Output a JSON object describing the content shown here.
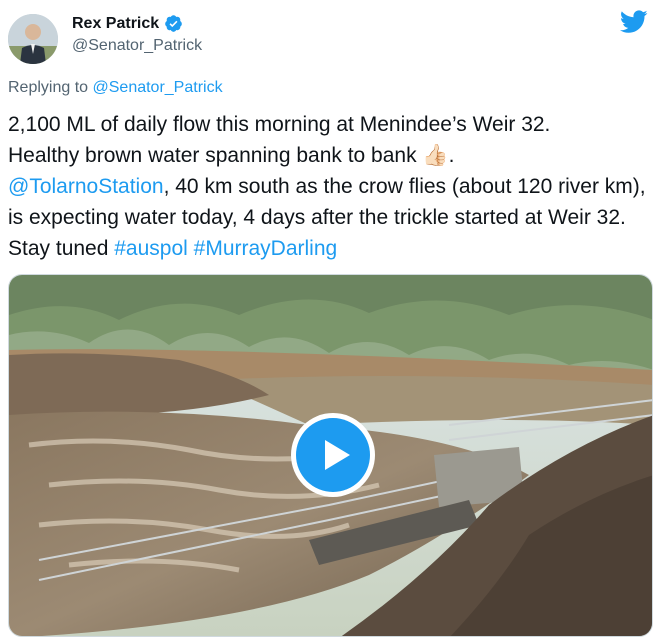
{
  "author": {
    "name": "Rex Patrick",
    "handle": "@Senator_Patrick"
  },
  "reply": {
    "prefix": "Replying to ",
    "mention": "@Senator_Patrick"
  },
  "tweet": {
    "line1": "2,100 ML of daily flow this morning at Menindee’s Weir 32.",
    "line2a": "Healthy brown water spanning bank to bank ",
    "emoji": "👍🏻",
    "line2b": ".",
    "mention": "@TolarnoStation",
    "line3": ", 40 km south as the crow flies (about 120 river km), is expecting water today, 4 days after the trickle started at Weir 32. Stay tuned ",
    "hashtag1": "#auspol",
    "space": " ",
    "hashtag2": "#MurrayDarling"
  },
  "icons": {
    "verified": "verified-badge-icon",
    "logo": "twitter-bird-icon",
    "play": "play-icon"
  },
  "colors": {
    "accent": "#1d9bf0",
    "secondary_text": "#536471",
    "primary_text": "#0f1419"
  }
}
